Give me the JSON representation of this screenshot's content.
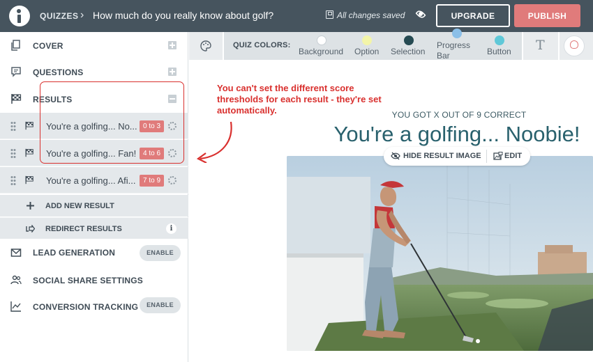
{
  "header": {
    "breadcrumb_root": "QUIZZES",
    "breadcrumb_separator": "›",
    "quiz_title": "How much do you really know about golf?",
    "save_status": "All changes saved",
    "upgrade_label": "UPGRADE",
    "publish_label": "PUBLISH",
    "publish_color": "#e07b7b"
  },
  "sidebar": {
    "cover_label": "COVER",
    "questions_label": "QUESTIONS",
    "results_label": "RESULTS",
    "results": [
      {
        "label": "You're a golfing... No...",
        "score": "0 to 3"
      },
      {
        "label": "You're a golfing... Fan!",
        "score": "4 to 6"
      },
      {
        "label": "You're a golfing... Afi...",
        "score": "7 to 9"
      }
    ],
    "add_result_label": "ADD NEW RESULT",
    "redirect_label": "REDIRECT RESULTS",
    "lead_generation_label": "LEAD GENERATION",
    "social_share_label": "SOCIAL SHARE SETTINGS",
    "conversion_tracking_label": "CONVERSION TRACKING",
    "enable_label": "ENABLE",
    "info_glyph": "i"
  },
  "color_toolbar": {
    "label": "QUIZ COLORS:",
    "swatches": [
      {
        "name": "Background",
        "color": "#ffffff"
      },
      {
        "name": "Option",
        "color": "#f3f5a9"
      },
      {
        "name": "Selection",
        "color": "#254a52"
      },
      {
        "name": "Progress Bar",
        "color": "#8bbfe8"
      },
      {
        "name": "Button",
        "color": "#5fc8d8"
      }
    ],
    "text_tool_glyph": "T"
  },
  "annotation": {
    "text": "You can't set the different score thresholds for each result - they're set automatically.",
    "color": "#d9302e"
  },
  "preview": {
    "score_line": "YOU GOT X OUT OF 9 CORRECT",
    "result_title": "You're a golfing... Noobie!",
    "hide_image_label": "HIDE RESULT IMAGE",
    "edit_label": "EDIT"
  }
}
